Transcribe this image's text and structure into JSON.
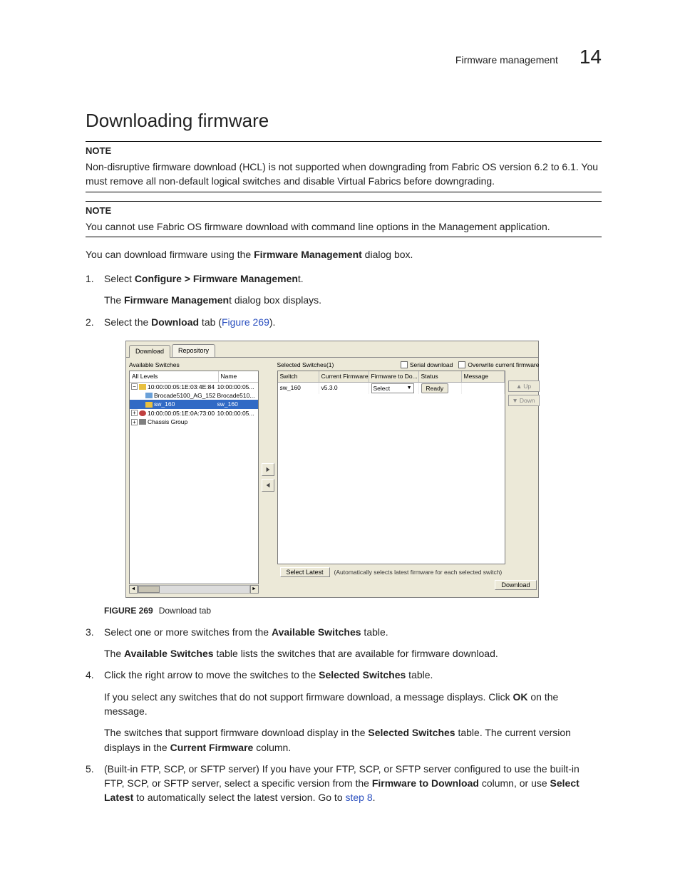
{
  "header": {
    "section": "Firmware management",
    "chapter": "14"
  },
  "title": "Downloading firmware",
  "note1": {
    "label": "NOTE",
    "body": "Non-disruptive firmware download (HCL) is not supported when downgrading from Fabric OS version 6.2 to 6.1. You must remove all non-default logical switches and disable Virtual Fabrics before downgrading."
  },
  "note2": {
    "label": "NOTE",
    "body": "You cannot use Fabric OS firmware download with command line options in the Management application."
  },
  "intro": {
    "pre": "You can download firmware using the ",
    "bold": "Firmware Management",
    "post": " dialog box."
  },
  "steps": {
    "s1": {
      "num": "1.",
      "pre": "Select ",
      "bold": "Configure > Firmware Managemen",
      "post": "t.",
      "sub_pre": "The ",
      "sub_bold": "Firmware Managemen",
      "sub_mid": "t dialog box displays."
    },
    "s2": {
      "num": "2.",
      "pre": "Select the ",
      "bold": "Download",
      "mid": " tab (",
      "link": "Figure 269",
      "post": ")."
    },
    "s3": {
      "num": "3.",
      "pre": "Select one or more switches from the ",
      "bold": "Available Switches",
      "post": " table.",
      "sub_pre": "The ",
      "sub_bold": "Available Switches",
      "sub_post": " table lists the switches that are available for firmware download."
    },
    "s4": {
      "num": "4.",
      "pre": "Click the right arrow to move the switches to the ",
      "bold": "Selected Switches",
      "post": " table.",
      "sub1_pre": "If you select any switches that do not support firmware download, a message displays. Click ",
      "sub1_bold": "OK",
      "sub1_post": " on the message.",
      "sub2_pre": "The switches that support firmware download display in the ",
      "sub2_bold1": "Selected Switches",
      "sub2_mid": " table. The current version displays in the ",
      "sub2_bold2": "Current Firmware",
      "sub2_post": " column."
    },
    "s5": {
      "num": "5.",
      "pre": "(Built-in FTP, SCP, or SFTP server) If you have your FTP, SCP, or SFTP server configured to use the built-in FTP, SCP, or SFTP server, select a specific version from the ",
      "bold1": "Firmware to Download",
      "mid1": " column, or use ",
      "bold2": "Select Latest",
      "mid2": " to automatically select the latest version. Go to ",
      "link": "step 8",
      "post": "."
    }
  },
  "figure": {
    "num": "FIGURE 269",
    "cap": "Download tab"
  },
  "dialog": {
    "tabs": {
      "t1": "Download",
      "t2": "Repository"
    },
    "left_label": "Available Switches",
    "tree_head": {
      "c1": "All Levels",
      "c2": "Name"
    },
    "tree": {
      "r1": {
        "c1": "10:00:00:05:1E:03:4E:84",
        "c2": "10:00:00:05..."
      },
      "r2": {
        "c1": "Brocade5100_AG_152",
        "c2": "Brocade510..."
      },
      "r3": {
        "c1": "sw_160",
        "c2": "sw_160"
      },
      "r4": {
        "c1": "10:00:00:05:1E:0A:73:00",
        "c2": "10:00:00:05..."
      },
      "r5": {
        "c1": "Chassis Group",
        "c2": ""
      }
    },
    "right": {
      "label": "Selected Switches(1)",
      "chk1": "Serial download",
      "chk2": "Overwrite current firmware",
      "head": {
        "c1": "Switch",
        "c2": "Current Firmware",
        "c3": "Firmware to Do...",
        "c4": "Status",
        "c5": "Message"
      },
      "row": {
        "c1": "sw_160",
        "c2": "v5.3.0",
        "c3": "Select",
        "c4": "Ready",
        "c5": ""
      }
    },
    "side": {
      "up": "Up",
      "down": "Down"
    },
    "bottom": {
      "btn": "Select Latest",
      "hint": "(Automatically selects latest firmware for each selected switch)",
      "download": "Download"
    }
  }
}
